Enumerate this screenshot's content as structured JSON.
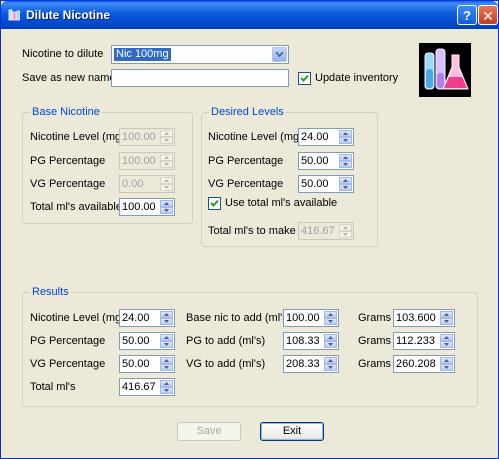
{
  "window": {
    "title": "Dilute Nicotine",
    "help_label": "?",
    "close_label": "✕",
    "icons": [
      "app-icon",
      "help-icon",
      "close-icon",
      "flask-logo-icon"
    ],
    "colors": {
      "titlebar": "#0054e3",
      "group_title": "#0046d5",
      "face": "#ece9d8",
      "selection": "#316ac5"
    }
  },
  "form": {
    "nicotine_label": "Nicotine to dilute",
    "nicotine_value": "Nic 100mg",
    "save_label": "Save as new name",
    "save_value": "",
    "update_label": "Update inventory",
    "update_checked": true
  },
  "base": {
    "title": "Base Nicotine",
    "fields": [
      {
        "label": "Nicotine Level (mg)",
        "value": "100.00",
        "enabled": false
      },
      {
        "label": "PG Percentage",
        "value": "100.00",
        "enabled": false
      },
      {
        "label": "VG Percentage",
        "value": "0.00",
        "enabled": false
      },
      {
        "label": "Total ml's available",
        "value": "100.00",
        "enabled": true
      }
    ]
  },
  "desired": {
    "title": "Desired Levels",
    "fields": [
      {
        "label": "Nicotine Level (mg)",
        "value": "24.00",
        "enabled": true
      },
      {
        "label": "PG Percentage",
        "value": "50.00",
        "enabled": true
      },
      {
        "label": "VG Percentage",
        "value": "50.00",
        "enabled": true
      }
    ],
    "use_total_label": "Use total ml's available",
    "use_total_checked": true,
    "total_to_make": {
      "label": "Total ml's to make",
      "value": "416.67",
      "enabled": false
    }
  },
  "results": {
    "title": "Results",
    "col1": [
      {
        "label": "Nicotine Level (mg)",
        "value": "24.00"
      },
      {
        "label": "PG Percentage",
        "value": "50.00"
      },
      {
        "label": "VG Percentage",
        "value": "50.00"
      },
      {
        "label": "Total ml's",
        "value": "416.67"
      }
    ],
    "col2": [
      {
        "label": "Base nic to add (ml's)",
        "value": "100.00"
      },
      {
        "label": "PG to add (ml's)",
        "value": "108.33"
      },
      {
        "label": "VG to add (ml's)",
        "value": "208.33"
      }
    ],
    "col3": [
      {
        "label": "Grams",
        "value": "103.600"
      },
      {
        "label": "Grams",
        "value": "112.233"
      },
      {
        "label": "Grams",
        "value": "260.208"
      }
    ]
  },
  "buttons": {
    "save_label": "Save",
    "save_enabled": false,
    "exit_label": "Exit"
  }
}
